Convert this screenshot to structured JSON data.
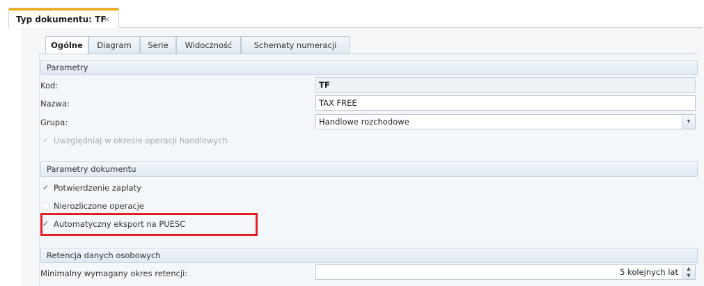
{
  "document_tab": {
    "title": "Typ dokumentu: TF",
    "close_glyph": "×"
  },
  "tabs": [
    {
      "label": "Ogólne",
      "active": true
    },
    {
      "label": "Diagram",
      "active": false
    },
    {
      "label": "Serie",
      "active": false
    },
    {
      "label": "Widoczność",
      "active": false
    },
    {
      "label": "Schematy numeracji",
      "active": false
    }
  ],
  "parametry": {
    "header": "Parametry",
    "kod_label": "Kod:",
    "kod_value": "TF",
    "nazwa_label": "Nazwa:",
    "nazwa_value": "TAX FREE",
    "grupa_label": "Grupa:",
    "grupa_value": "Handlowe rozchodowe",
    "uwzgledniaj": {
      "label": "Uwzględniaj w okresie operacji handlowych",
      "checked": true,
      "disabled": true
    }
  },
  "parametry_dokumentu": {
    "header": "Parametry dokumentu",
    "items": [
      {
        "label": "Potwierdzenie zapłaty",
        "checked": true
      },
      {
        "label": "Nierozliczone operacje",
        "checked": false
      },
      {
        "label": "Automatyczny eksport na PUESC",
        "checked": true
      }
    ]
  },
  "retencja": {
    "header": "Retencja danych osobowych",
    "okres_label": "Minimalny wymagany okres retencji:",
    "okres_value": "5 kolejnych lat"
  },
  "icons": {
    "check": "✓",
    "dropdown": "▾",
    "spin_up": "▲",
    "spin_down": "▼"
  },
  "colors": {
    "highlight": "#e02020",
    "accent_tab": "#f0a200"
  }
}
